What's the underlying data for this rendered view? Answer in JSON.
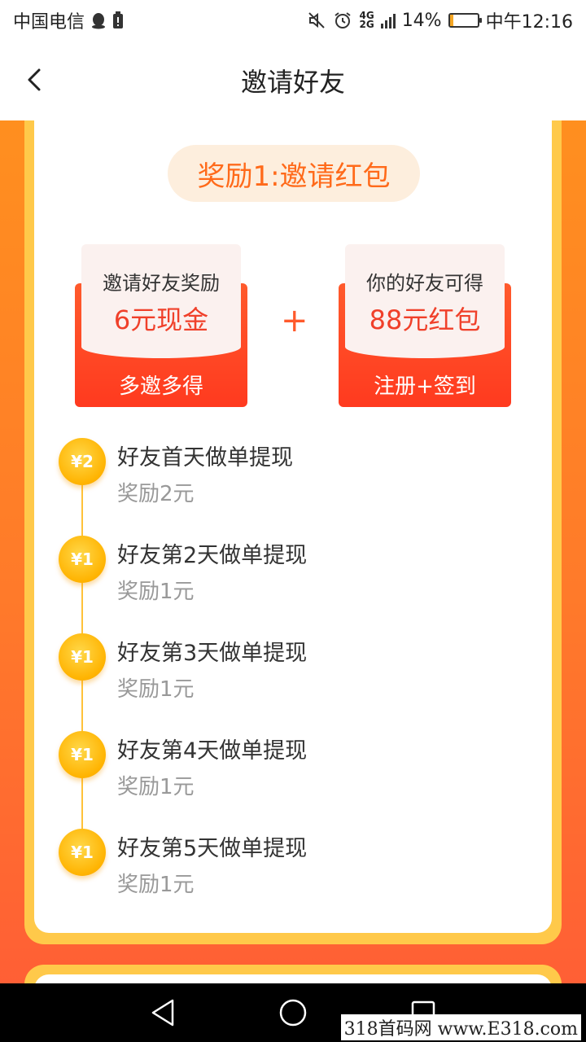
{
  "status_bar": {
    "carrier": "中国电信",
    "network_top": "4G",
    "network_bottom": "2G",
    "battery_percent": "14%",
    "battery_level": 0.14,
    "time": "中午12:16"
  },
  "nav": {
    "title": "邀请好友"
  },
  "reward_section": {
    "pill_title": "奖励1:邀请红包",
    "left": {
      "label": "邀请好友奖励",
      "amount": "6元现金",
      "action": "多邀多得"
    },
    "right": {
      "label": "你的好友可得",
      "amount": "88元红包",
      "action": "注册+签到"
    },
    "plus": "+"
  },
  "steps": [
    {
      "coin": "¥2",
      "title": "好友首天做单提现",
      "reward": "奖励2元"
    },
    {
      "coin": "¥1",
      "title": "好友第2天做单提现",
      "reward": "奖励1元"
    },
    {
      "coin": "¥1",
      "title": "好友第3天做单提现",
      "reward": "奖励1元"
    },
    {
      "coin": "¥1",
      "title": "好友第4天做单提现",
      "reward": "奖励1元"
    },
    {
      "coin": "¥1",
      "title": "好友第5天做单提现",
      "reward": "奖励1元"
    }
  ],
  "watermark": "318首码网 www.E318.com",
  "colors": {
    "accent_orange": "#ff6a1a",
    "red": "#f0402a",
    "gold": "#ffb300"
  }
}
